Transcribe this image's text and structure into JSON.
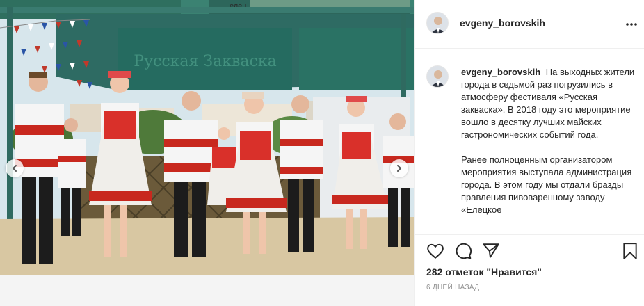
{
  "post": {
    "username": "evgeny_borovskih",
    "caption_user": "evgeny_borovskih",
    "caption_lines": [
      "На выходных жители города в седьмой раз погрузились в атмосферу фестиваля «Русская закваска». В 2018 году это мероприятие вошло в десятку лучших майских гастрономических событий года.",
      "Ранее полноценным организатором мероприятия выступала администрация города. В этом году мы отдали бразды правления пивоваренному заводу «Елецкое"
    ],
    "likes": "282 отметок \"Нравится\"",
    "date": "6 дней назад"
  },
  "media": {
    "banner_text": "Русская Закваска",
    "sign_text": "елец",
    "prev_label": "‹",
    "next_label": "›"
  },
  "icons": {
    "more": "more-icon",
    "like": "heart-icon",
    "comment": "comment-icon",
    "share": "share-icon",
    "save": "bookmark-icon"
  },
  "colors": {
    "text": "#262626",
    "muted": "#8e8e8e",
    "border": "#efefef"
  }
}
